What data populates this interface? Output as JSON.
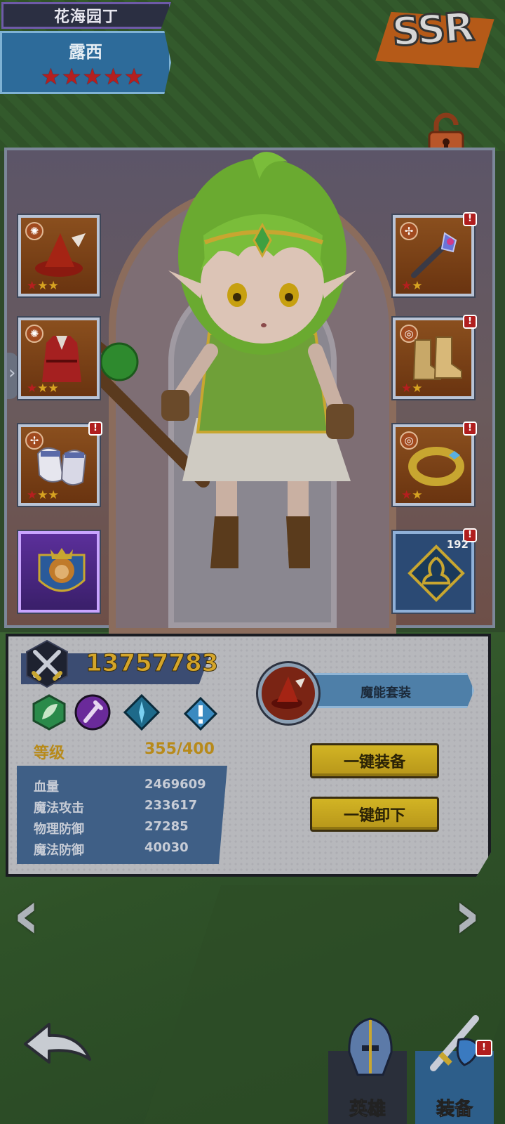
{
  "header": {
    "title": "花海园丁",
    "hero_name": "露西",
    "stars": 5,
    "rarity": "SSR"
  },
  "equipment": {
    "left": [
      {
        "name": "hat",
        "stars": 3
      },
      {
        "name": "robe",
        "stars": 3
      },
      {
        "name": "gloves",
        "stars": 3,
        "alert": "!"
      },
      {
        "name": "emblem"
      }
    ],
    "right": [
      {
        "name": "staff",
        "stars": 2,
        "alert": "!"
      },
      {
        "name": "boots",
        "stars": 2,
        "alert": "!"
      },
      {
        "name": "ring",
        "stars": 2,
        "alert": "!"
      },
      {
        "name": "rune",
        "count": "192",
        "alert": "!"
      }
    ]
  },
  "stats": {
    "power": "13757783",
    "level_label": "等级",
    "level_value": "355/400",
    "rows": [
      {
        "label": "血量",
        "value": "2469609"
      },
      {
        "label": "魔法攻击",
        "value": "233617"
      },
      {
        "label": "物理防御",
        "value": "27285"
      },
      {
        "label": "魔法防御",
        "value": "40030"
      }
    ]
  },
  "set": {
    "label": "魔能套装"
  },
  "actions": {
    "equip_all": "一键装备",
    "unequip_all": "一键卸下"
  },
  "nav": {
    "prev": "‹",
    "next": "›"
  },
  "tabs": [
    {
      "label": "英雄",
      "alert": ""
    },
    {
      "label": "装备",
      "alert": "!"
    }
  ],
  "colors": {
    "gold_text": "#d4a52a",
    "star_red": "#b51f1f",
    "panel": "#b7b8bc",
    "button_yellow": "#c9a920"
  }
}
